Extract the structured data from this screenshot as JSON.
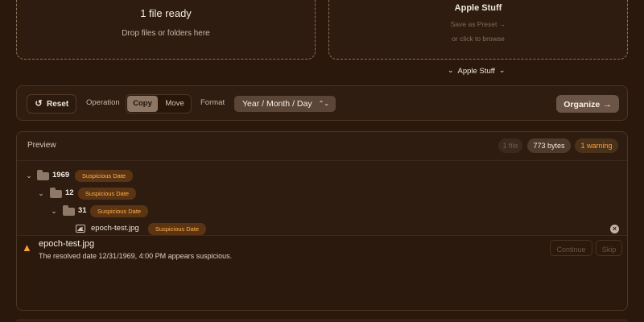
{
  "dropzones": {
    "source": {
      "status": "1 file ready",
      "hint": "Drop files or folders here"
    },
    "preset": {
      "title": "Apple Stuff",
      "save_action": "Save as Preset →",
      "browse_hint": "or click to browse"
    },
    "selected_preset": "Apple Stuff",
    "selected_preset_icon": "chevron-down-icon"
  },
  "toolbar": {
    "reset_label": "Reset",
    "reset_icon": "reset-icon",
    "operation_label": "Operation",
    "operations": [
      {
        "label": "Copy",
        "selected": true
      },
      {
        "label": "Move",
        "selected": false
      }
    ],
    "format_label": "Format",
    "format_value": "Year / Month / Day",
    "organize_label": "Organize",
    "organize_icon": "arrow-right-icon"
  },
  "preview": {
    "title": "Preview",
    "stats": {
      "files": "1 file",
      "size": "773 bytes",
      "warnings": "1 warning"
    },
    "tree": [
      {
        "name": "1969",
        "badge": "Suspicious Date",
        "icon": "folder-icon",
        "expanded": true
      },
      {
        "name": "12",
        "badge": "Suspicious Date",
        "icon": "folder-icon",
        "expanded": true
      },
      {
        "name": "31",
        "badge": "Suspicious Date",
        "icon": "folder-icon",
        "expanded": true
      },
      {
        "name": "epoch-test.jpg",
        "badge": "Suspicious Date",
        "icon": "image-icon",
        "expanded": false
      }
    ]
  },
  "warning": {
    "icon": "warning-icon",
    "file_name": "epoch-test.jpg",
    "message": "The resolved date 12/31/1969, 4:00 PM appears suspicious.",
    "continue_label": "Continue",
    "skip_label": "Skip"
  },
  "colors": {
    "background": "#2a180c",
    "panel": "#2f1d11",
    "warning_accent": "#ff9f2e",
    "badge_text": "#ffb04c"
  }
}
